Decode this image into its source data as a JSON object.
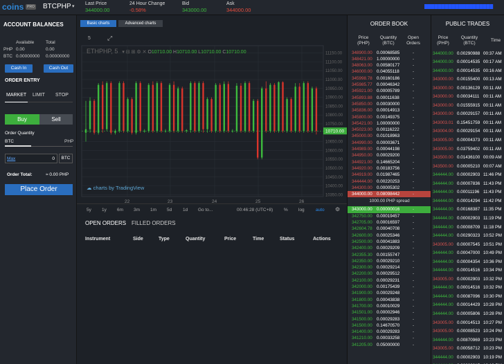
{
  "topbar": {
    "logo": "coins",
    "logo_badge": "PRO",
    "pair": "BTCPHP",
    "pair_caret": "▾",
    "stats": [
      {
        "label": "Last Price",
        "value": "344000.00",
        "color": "#3dbb3d"
      },
      {
        "label": "24 Hour Change",
        "value": "-0.58%",
        "color": "#e74c3c"
      },
      {
        "label": "Bid",
        "value": "343000.00",
        "color": "#3dbb3d"
      },
      {
        "label": "Ask",
        "value": "344000.00",
        "color": "#e74c3c"
      }
    ],
    "user_link": "████████████████████"
  },
  "balances": {
    "title": "ACCOUNT BALANCES",
    "col_available": "Available",
    "col_total": "Total",
    "rows": [
      {
        "cur": "PHP",
        "available": "0.00",
        "total": "0.00"
      },
      {
        "cur": "BTC",
        "available": "0.00000000",
        "total": "0.00000000"
      }
    ],
    "cash_in": "Cash In",
    "cash_out": "Cash Out"
  },
  "order_entry": {
    "title": "ORDER ENTRY",
    "tabs": [
      "MARKET",
      "LIMIT",
      "STOP"
    ],
    "buy": "Buy",
    "sell": "Sell",
    "qty_label": "Order Quantity",
    "slider_left": "BTC",
    "slider_right": "PHP",
    "max": "Max",
    "qty_value": "0",
    "qty_unit": "BTC",
    "total_label": "Order Total:",
    "total_value": "≈ 0.00 PHP",
    "place": "Place Order"
  },
  "chart": {
    "tab_basic": "Basic charts",
    "tab_advanced": "Advanced charts",
    "interval": "5",
    "symbol": "ETHPHP, 5",
    "ohlc": [
      "10710.00",
      "10710.00",
      "10710.00",
      "10710.00"
    ],
    "watermark": "charts by TradingView",
    "y_ticks": [
      "11150.00",
      "11100.00",
      "11050.00",
      "11000.00",
      "10950.00",
      "10900.00",
      "10850.00",
      "10800.00",
      "10750.00",
      "10710.00",
      "10650.00",
      "10600.00",
      "10550.00",
      "10500.00",
      "10450.00",
      "10400.00",
      "10350.00"
    ],
    "current_price": "10710.00",
    "x_ticks": [
      "22",
      "23",
      "24",
      "25",
      "26"
    ],
    "ranges": [
      "5y",
      "1y",
      "6m",
      "3m",
      "1m",
      "5d",
      "1d",
      "Go to..."
    ],
    "time": "00:46:28 (UTC+8)",
    "opts": [
      "%",
      "log",
      "auto"
    ],
    "colors": {
      "up": "#3dbb3d",
      "down": "#d9342b"
    }
  },
  "chart_data": {
    "type": "candlestick",
    "ylim": [
      10340,
      11160
    ],
    "candles": [
      [
        10700,
        10880,
        10650,
        10720
      ],
      [
        10720,
        10900,
        10700,
        10880
      ],
      [
        10880,
        10890,
        10690,
        10700
      ],
      [
        10700,
        10980,
        10690,
        10970
      ],
      [
        10970,
        10990,
        10700,
        10720
      ],
      [
        10720,
        10990,
        10710,
        10980
      ],
      [
        10980,
        10990,
        10690,
        10700
      ],
      [
        10700,
        10720,
        10690,
        10710
      ],
      [
        10710,
        10990,
        10700,
        10980
      ],
      [
        10980,
        10990,
        10700,
        10710
      ],
      [
        10710,
        10900,
        10700,
        10890
      ],
      [
        10890,
        10900,
        10690,
        10700
      ],
      [
        10700,
        10990,
        10690,
        10980
      ],
      [
        10980,
        10990,
        10700,
        10710
      ],
      [
        10710,
        10720,
        10700,
        10710
      ],
      [
        10710,
        10980,
        10700,
        10970
      ],
      [
        10970,
        10990,
        10700,
        10710
      ],
      [
        10710,
        10990,
        10700,
        10980
      ],
      [
        10980,
        10990,
        10700,
        10710
      ],
      [
        10710,
        10720,
        10700,
        10710
      ],
      [
        10710,
        10980,
        10700,
        10970
      ],
      [
        10970,
        10990,
        10700,
        10710
      ],
      [
        10710,
        10960,
        10700,
        10950
      ],
      [
        10950,
        10960,
        10700,
        10710
      ],
      [
        10710,
        10720,
        10700,
        10715
      ],
      [
        10715,
        10990,
        10700,
        10980
      ],
      [
        10980,
        10990,
        10700,
        10710
      ],
      [
        10710,
        10990,
        10700,
        10980
      ],
      [
        10980,
        10990,
        10700,
        10720
      ],
      [
        10720,
        10900,
        10700,
        10890
      ],
      [
        10890,
        10900,
        10700,
        10710
      ],
      [
        10710,
        10980,
        10700,
        10970
      ],
      [
        10970,
        10980,
        10700,
        10710
      ],
      [
        10710,
        10990,
        10700,
        10975
      ],
      [
        10975,
        10990,
        10700,
        10710
      ],
      [
        10710,
        10720,
        10700,
        10710
      ],
      [
        10710,
        10980,
        10700,
        10965
      ],
      [
        10965,
        10980,
        10700,
        10710
      ],
      [
        10710,
        10990,
        10700,
        10980
      ],
      [
        10980,
        10990,
        10700,
        10710
      ],
      [
        10710,
        10890,
        10700,
        10880
      ],
      [
        10880,
        10890,
        10550,
        10560
      ],
      [
        10560,
        10960,
        10550,
        10950
      ],
      [
        10950,
        10990,
        10700,
        10710
      ],
      [
        10710,
        10980,
        10700,
        10970
      ],
      [
        10970,
        10980,
        10700,
        10710
      ],
      [
        10710,
        10990,
        10700,
        10985
      ],
      [
        10985,
        10990,
        10700,
        10710
      ],
      [
        10710,
        10900,
        10700,
        10890
      ],
      [
        10890,
        10900,
        10700,
        10710
      ],
      [
        10710,
        10980,
        10700,
        10960
      ],
      [
        10960,
        10980,
        10700,
        10710
      ],
      [
        10710,
        10990,
        10700,
        10980
      ],
      [
        10980,
        10990,
        10700,
        10710
      ],
      [
        10710,
        10960,
        10700,
        10950
      ],
      [
        10950,
        10960,
        10690,
        10710
      ]
    ]
  },
  "orders": {
    "tab_open": "OPEN ORDERS",
    "tab_filled": "FILLED ORDERS",
    "columns": [
      "Instrument",
      "Side",
      "Type",
      "Quantity",
      "Price",
      "Time",
      "Status",
      "Actions"
    ]
  },
  "order_book": {
    "title": "ORDER BOOK",
    "col_price": "Price\n(PHP)",
    "col_qty": "Quantity\n(BTC)",
    "col_open": "Open\nOrders",
    "asks": [
      [
        "348900.00",
        "0.00068585"
      ],
      [
        "348421.00",
        "1.00000000"
      ],
      [
        "348063.00",
        "0.00580177"
      ],
      [
        "346000.00",
        "0.04055118"
      ],
      [
        "345998.78",
        "0.00160186"
      ],
      [
        "345985.77",
        "0.00046342"
      ],
      [
        "345921.00",
        "0.00005789"
      ],
      [
        "345893.88",
        "0.00011638"
      ],
      [
        "345850.00",
        "0.00030000"
      ],
      [
        "345836.00",
        "0.00014913"
      ],
      [
        "345800.00",
        "0.00149375"
      ],
      [
        "345421.00",
        "1.00000000"
      ],
      [
        "345023.00",
        "0.00116222"
      ],
      [
        "345000.00",
        "0.01018963"
      ],
      [
        "344990.00",
        "0.00003671"
      ],
      [
        "344989.00",
        "0.00044198"
      ],
      [
        "344950.00",
        "0.00029200"
      ],
      [
        "344921.00",
        "0.14665204"
      ],
      [
        "344920.00",
        "0.00183756"
      ],
      [
        "344919.00",
        "0.01987465"
      ],
      [
        "344444.00",
        "0.00220253"
      ],
      [
        "344300.00",
        "0.00005302"
      ],
      [
        "344000.00",
        "0.08098442"
      ]
    ],
    "spread": "1000.00 PHP spread",
    "bids": [
      [
        "343000.00",
        "0.00000016"
      ],
      [
        "342750.00",
        "0.00019457"
      ],
      [
        "342705.00",
        "0.00016597"
      ],
      [
        "342604.78",
        "0.00040708"
      ],
      [
        "342600.00",
        "0.00025346"
      ],
      [
        "342500.00",
        "0.00041883"
      ],
      [
        "342400.00",
        "0.00029209"
      ],
      [
        "342355.30",
        "0.00155747"
      ],
      [
        "342350.00",
        "0.00029210"
      ],
      [
        "342300.00",
        "0.00029214"
      ],
      [
        "342200.00",
        "0.00029512"
      ],
      [
        "342100.00",
        "0.00029231"
      ],
      [
        "342000.00",
        "0.00175439"
      ],
      [
        "341900.00",
        "0.00029248"
      ],
      [
        "341800.00",
        "0.00043838"
      ],
      [
        "341700.00",
        "0.00010029"
      ],
      [
        "341501.00",
        "0.00002946"
      ],
      [
        "341500.00",
        "0.00029283"
      ],
      [
        "341500.00",
        "0.14670570"
      ],
      [
        "341400.00",
        "0.00029283"
      ],
      [
        "341210.00",
        "0.00033258"
      ],
      [
        "341205.00",
        "0.05000000"
      ]
    ]
  },
  "public_trades": {
    "title": "PUBLIC TRADES",
    "col_price": "Price\n(PHP)",
    "col_qty": "Quantity\n(BTC)",
    "col_time": "Time",
    "rows": [
      [
        "344000.00",
        "0.00290988",
        "00:37 AM",
        "g"
      ],
      [
        "344000.00",
        "0.00014535",
        "00:17 AM",
        "g"
      ],
      [
        "344000.00",
        "0.00014535",
        "00:16 AM",
        "g"
      ],
      [
        "343000.00",
        "0.00155400",
        "00:13 AM",
        "r"
      ],
      [
        "343000.00",
        "0.00136129",
        "00:11 AM",
        "r"
      ],
      [
        "343000.00",
        "0.00034111",
        "00:11 AM",
        "r"
      ],
      [
        "343000.00",
        "0.01555915",
        "00:11 AM",
        "r"
      ],
      [
        "343000.00",
        "0.00029157",
        "00:11 AM",
        "r"
      ],
      [
        "343003.01",
        "0.15451759",
        "00:11 AM",
        "r"
      ],
      [
        "343004.00",
        "0.00029154",
        "00:11 AM",
        "r"
      ],
      [
        "343005.00",
        "0.00004373",
        "00:11 AM",
        "r"
      ],
      [
        "343005.00",
        "0.03759402",
        "00:11 AM",
        "r"
      ],
      [
        "343500.00",
        "0.01436100",
        "00:09 AM",
        "r"
      ],
      [
        "343500.00",
        "0.00005210",
        "00:07 AM",
        "r"
      ],
      [
        "344444.00",
        "0.00002903",
        "11:46 PM",
        "g"
      ],
      [
        "344444.00",
        "0.00007836",
        "11:43 PM",
        "g"
      ],
      [
        "344444.00",
        "0.00011196",
        "11:43 PM",
        "g"
      ],
      [
        "344444.00",
        "0.00014294",
        "11:42 PM",
        "g"
      ],
      [
        "344444.00",
        "0.00168387",
        "11:35 PM",
        "g"
      ],
      [
        "344444.00",
        "0.00002903",
        "11:19 PM",
        "g"
      ],
      [
        "344444.00",
        "0.00008709",
        "11:18 PM",
        "g"
      ],
      [
        "344444.00",
        "0.00290323",
        "10:52 PM",
        "g"
      ],
      [
        "343005.00",
        "0.00007545",
        "10:51 PM",
        "r"
      ],
      [
        "344444.00",
        "0.00047000",
        "10:49 PM",
        "g"
      ],
      [
        "344444.00",
        "0.00004354",
        "10:36 PM",
        "g"
      ],
      [
        "344444.00",
        "0.00014516",
        "10:34 PM",
        "g"
      ],
      [
        "343005.00",
        "0.00002903",
        "10:32 PM",
        "r"
      ],
      [
        "344444.00",
        "0.00014516",
        "10:32 PM",
        "g"
      ],
      [
        "344444.00",
        "0.00087096",
        "10:30 PM",
        "g"
      ],
      [
        "344444.00",
        "0.00014429",
        "10:28 PM",
        "g"
      ],
      [
        "344444.00",
        "0.00005806",
        "10:28 PM",
        "g"
      ],
      [
        "343005.00",
        "0.00014513",
        "10:27 PM",
        "r"
      ],
      [
        "343005.00",
        "0.00008523",
        "10:24 PM",
        "r"
      ],
      [
        "344444.00",
        "0.00870969",
        "10:23 PM",
        "g"
      ],
      [
        "343005.00",
        "0.00058712",
        "10:23 PM",
        "r"
      ],
      [
        "344444.00",
        "0.00002903",
        "10:19 PM",
        "g"
      ],
      [
        "344444.00",
        "0.00002915",
        "10:19 PM",
        "g"
      ],
      [
        "344444.00",
        "0.00435440",
        "10:19 PM",
        "g"
      ]
    ]
  }
}
